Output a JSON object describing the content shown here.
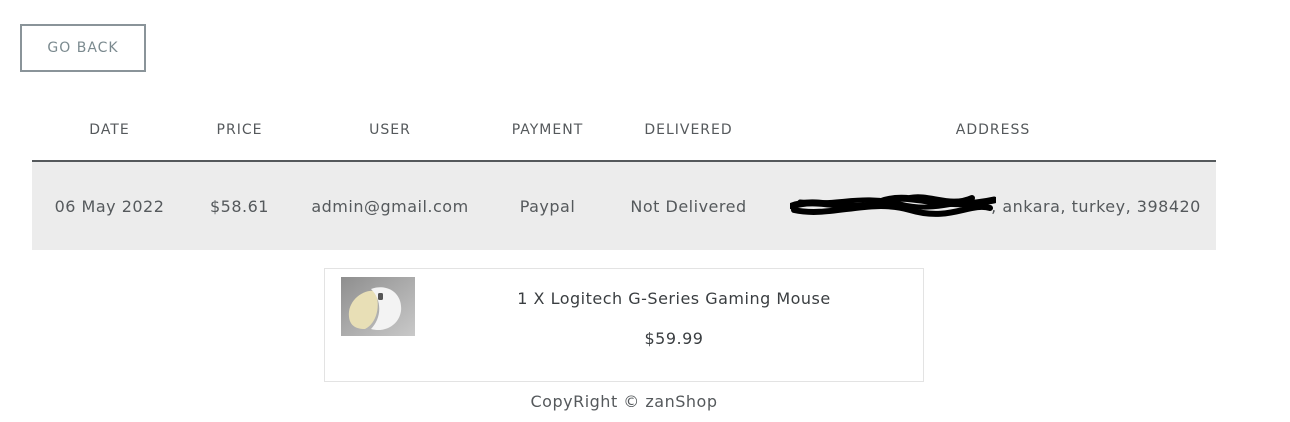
{
  "back_button": {
    "label": "GO BACK"
  },
  "table": {
    "headers": [
      "DATE",
      "PRICE",
      "USER",
      "PAYMENT",
      "DELIVERED",
      "ADDRESS"
    ],
    "row": {
      "date": "06 May 2022",
      "price": "$58.61",
      "user": "admin@gmail.com",
      "payment": "Paypal",
      "delivered": "Not Delivered",
      "address_visible": ", ankara, turkey, 398420"
    }
  },
  "order_item": {
    "name": "1 X Logitech G-Series Gaming Mouse",
    "price": "$59.99",
    "image_icon": "mouse-product-image"
  },
  "footer": {
    "text": "CopyRight © zanShop"
  },
  "colors": {
    "text": "#55595c",
    "row_background": "#ececec",
    "button_border": "#8a9499"
  }
}
